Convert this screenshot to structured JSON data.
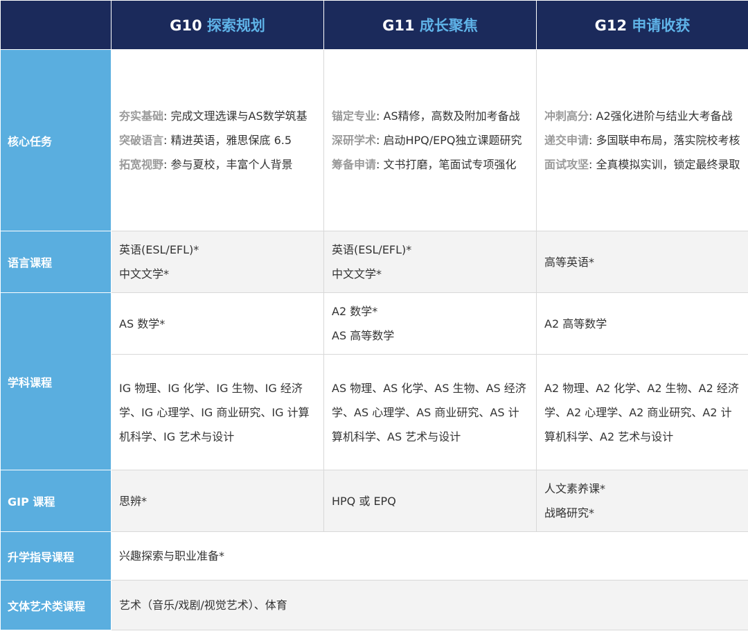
{
  "header": {
    "columns": [
      {
        "grade": "G10",
        "title": "探索规划"
      },
      {
        "grade": "G11",
        "title": "成长聚焦"
      },
      {
        "grade": "G12",
        "title": "申请收获"
      }
    ]
  },
  "rows": {
    "core": {
      "label": "核心任务",
      "g10": [
        {
          "key": "夯实基础",
          "sep": ": ",
          "text": "完成文理选课与AS数学筑基"
        },
        {
          "key": "突破语言",
          "sep": ": ",
          "text": "精进英语，雅思保底 6.5"
        },
        {
          "key": "拓宽视野",
          "sep": ": ",
          "text": "参与夏校，丰富个人背景"
        }
      ],
      "g11": [
        {
          "key": "锚定专业",
          "sep": ": ",
          "text": "AS精修，高数及附加考备战"
        },
        {
          "key": "深研学术",
          "sep": ": ",
          "text": "启动HPQ/EPQ独立课题研究"
        },
        {
          "key": "筹备申请",
          "sep": ": ",
          "text": "文书打磨，笔面试专项强化"
        }
      ],
      "g12": [
        {
          "key": "冲刺高分",
          "sep": ": ",
          "text": "A2强化进阶与结业大考备战"
        },
        {
          "key": "递交申请",
          "sep": ": ",
          "text": "多国联申布局，落实院校考核"
        },
        {
          "key": "面试攻坚",
          "sep": ": ",
          "text": "全真模拟实训，锁定最终录取"
        }
      ]
    },
    "language": {
      "label": "语言课程",
      "g10": [
        "英语(ESL/EFL)*",
        "中文文学*"
      ],
      "g11": [
        "英语(ESL/EFL)*",
        "中文文学*"
      ],
      "g12": [
        "高等英语*"
      ]
    },
    "subject": {
      "label": "学科课程",
      "math": {
        "g10": [
          "AS 数学*"
        ],
        "g11": [
          "A2 数学*",
          "AS 高等数学"
        ],
        "g12": [
          "A2 高等数学"
        ]
      },
      "electives": {
        "g10": "IG 物理、IG 化学、IG 生物、IG 经济学、IG 心理学、IG 商业研究、IG 计算机科学、IG 艺术与设计",
        "g11": "AS 物理、AS 化学、AS 生物、AS 经济学、AS 心理学、AS 商业研究、AS 计算机科学、AS 艺术与设计",
        "g12": "A2 物理、A2 化学、A2 生物、A2 经济学、A2 心理学、A2 商业研究、A2 计算机科学、A2 艺术与设计"
      }
    },
    "gip": {
      "label": "GIP 课程",
      "g10": [
        "思辨*"
      ],
      "g11": [
        "HPQ 或 EPQ"
      ],
      "g12": [
        "人文素养课*",
        "战略研究*"
      ]
    },
    "guidance": {
      "label": "升学指导课程",
      "all": "兴趣探索与职业准备*"
    },
    "arts": {
      "label": "文体艺术类课程",
      "all": "艺术（音乐/戏剧/视觉艺术）、体育"
    }
  },
  "colors": {
    "header_bg": "#1b2a5b",
    "header_accent": "#5fb3e8",
    "label_bg": "#5aaedf",
    "keyword": "#9a9a9a",
    "grey_cell": "#f3f3f3"
  }
}
